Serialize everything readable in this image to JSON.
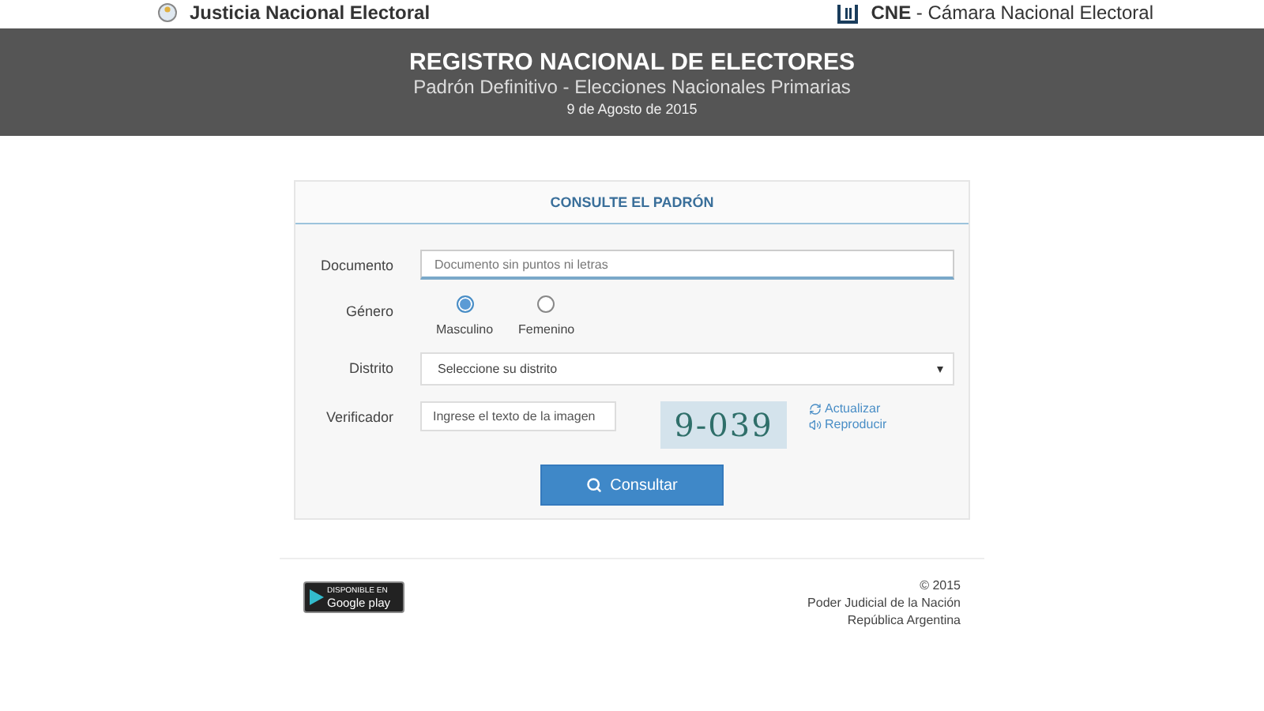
{
  "topbar": {
    "left": "Justicia Nacional Electoral",
    "right_bold": "CNE",
    "right_rest": " - Cámara Nacional Electoral"
  },
  "header": {
    "title": "REGISTRO NACIONAL DE ELECTORES",
    "subtitle": "Padrón Definitivo - Elecciones Nacionales Primarias",
    "date": "9 de Agosto de 2015"
  },
  "form": {
    "title": "CONSULTE EL PADRÓN",
    "documento": {
      "label": "Documento",
      "placeholder": "Documento sin puntos ni letras"
    },
    "genero": {
      "label": "Género",
      "options": [
        {
          "label": "Masculino",
          "selected": true
        },
        {
          "label": "Femenino",
          "selected": false
        }
      ]
    },
    "distrito": {
      "label": "Distrito",
      "value": "Seleccione su distrito"
    },
    "verificador": {
      "label": "Verificador",
      "placeholder": "Ingrese el texto de la imagen",
      "captcha": "9-039",
      "links": [
        "Actualizar",
        "Reproducir"
      ]
    },
    "button": "Consultar"
  },
  "footer": {
    "badge_top": "DISPONIBLE EN",
    "badge_main": "Google play",
    "lines": [
      "© 2015",
      "Poder Judicial de la Nación",
      "República Argentina"
    ]
  }
}
